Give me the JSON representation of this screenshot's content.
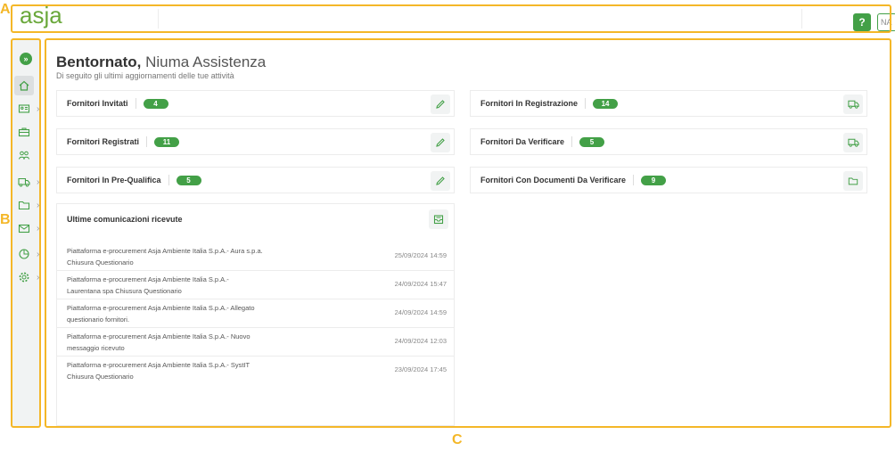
{
  "annotations": {
    "a": "A",
    "b": "B",
    "c": "C"
  },
  "header": {
    "logo_text": "asja",
    "help_label": "?",
    "user_initials": "NA"
  },
  "sidebar": {
    "expand_icon": "double-chevron-right-icon",
    "items": [
      {
        "icon": "home-icon",
        "has_submenu": false,
        "active": true
      },
      {
        "icon": "id-card-icon",
        "has_submenu": true
      },
      {
        "icon": "briefcase-icon",
        "has_submenu": false
      },
      {
        "icon": "users-icon",
        "has_submenu": false
      },
      {
        "icon": "truck-icon",
        "has_submenu": true
      },
      {
        "icon": "folder-icon",
        "has_submenu": true
      },
      {
        "icon": "envelope-icon",
        "has_submenu": true
      },
      {
        "icon": "pie-chart-icon",
        "has_submenu": true
      },
      {
        "icon": "gear-icon",
        "has_submenu": true
      }
    ]
  },
  "main": {
    "welcome": "Bentornato,",
    "user_name": "Niuma Assistenza",
    "subtitle": "Di seguito gli ultimi aggiornamenti delle tue attività",
    "cards_left": [
      {
        "label": "Fornitori Invitati",
        "count": "4",
        "action_icon": "pencil-icon"
      },
      {
        "label": "Fornitori Registrati",
        "count": "11",
        "action_icon": "pencil-icon"
      },
      {
        "label": "Fornitori In Pre-Qualifica",
        "count": "5",
        "action_icon": "pencil-icon"
      }
    ],
    "cards_right": [
      {
        "label": "Fornitori In Registrazione",
        "count": "14",
        "action_icon": "truck-icon"
      },
      {
        "label": "Fornitori Da Verificare",
        "count": "5",
        "action_icon": "truck-icon"
      },
      {
        "label": "Fornitori Con Documenti Da Verificare",
        "count": "9",
        "action_icon": "folder-icon"
      }
    ],
    "communications": {
      "title": "Ultime comunicazioni ricevute",
      "action_icon": "inbox-icon",
      "messages": [
        {
          "text": "Piattaforma e-procurement Asja Ambiente Italia S.p.A.- Aura s.p.a. Chiusura Questionario",
          "date": "25/09/2024 14:59"
        },
        {
          "text": "Piattaforma e-procurement Asja Ambiente Italia S.p.A.- Laurentana spa Chiusura Questionario",
          "date": "24/09/2024 15:47"
        },
        {
          "text": "Piattaforma e-procurement Asja Ambiente Italia S.p.A.- Allegato questionario fornitori.",
          "date": "24/09/2024 14:59"
        },
        {
          "text": "Piattaforma e-procurement Asja Ambiente Italia S.p.A.- Nuovo messaggio ricevuto",
          "date": "24/09/2024 12:03"
        },
        {
          "text": "Piattaforma e-procurement Asja Ambiente Italia S.p.A.- SystIT Chiusura Questionario",
          "date": "23/09/2024 17:45"
        }
      ]
    }
  },
  "colors": {
    "accent": "#43a047",
    "annotation": "#f4b728"
  }
}
